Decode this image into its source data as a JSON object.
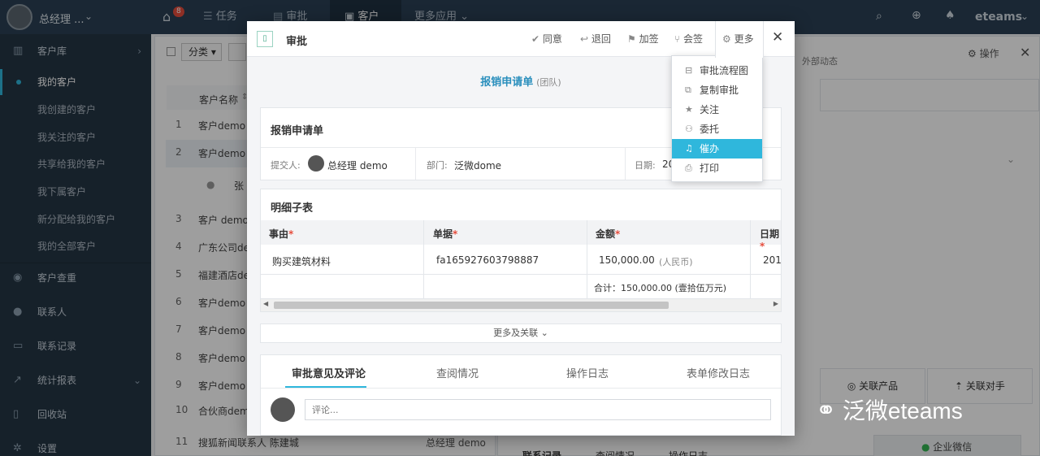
{
  "topbar": {
    "user": "总经理 ...",
    "home_badge": "8",
    "nav": [
      "任务",
      "审批",
      "客户",
      "更多应用"
    ],
    "brand": "eteams"
  },
  "sidebar": {
    "items": [
      {
        "label": "客户库",
        "icon": "bar-chart-icon",
        "main": true
      },
      {
        "label": "我的客户",
        "active": true
      },
      {
        "label": "我创建的客户"
      },
      {
        "label": "我关注的客户"
      },
      {
        "label": "共享给我的客户"
      },
      {
        "label": "我下属客户"
      },
      {
        "label": "新分配给我的客户"
      },
      {
        "label": "我的全部客户"
      },
      {
        "label": "客户查重",
        "icon": "eye-icon",
        "main": true
      },
      {
        "label": "联系人",
        "icon": "user-icon",
        "main": true
      },
      {
        "label": "联系记录",
        "icon": "comment-icon",
        "main": true
      },
      {
        "label": "统计报表",
        "icon": "line-chart-icon",
        "main": true
      },
      {
        "label": "回收站",
        "icon": "trash-icon",
        "main": true
      },
      {
        "label": "设置",
        "icon": "gear-icon",
        "main": true
      }
    ]
  },
  "background": {
    "filter_label": "分类",
    "col_name": "客户名称",
    "rows": [
      {
        "n": "1",
        "name": "客户demo"
      },
      {
        "n": "2",
        "name": "客户demo"
      },
      {
        "n": "",
        "name": "张"
      },
      {
        "n": "3",
        "name": "客户 demo"
      },
      {
        "n": "4",
        "name": "广东公司de"
      },
      {
        "n": "5",
        "name": "福建酒店de"
      },
      {
        "n": "6",
        "name": "客户demo"
      },
      {
        "n": "7",
        "name": "客户demo"
      },
      {
        "n": "8",
        "name": "客户demo"
      },
      {
        "n": "9",
        "name": "客户demo"
      },
      {
        "n": "10",
        "name": "合伙商dem"
      },
      {
        "n": "11",
        "name": "搜狐新闻联系人 陈建城"
      }
    ],
    "row11_owner": "总经理 demo",
    "right_tab": "外部动态",
    "right_action": "操作",
    "related_product": "关联产品",
    "related_rival": "关联对手",
    "bottom_tabs": [
      "联系记录",
      "查阅情况",
      "操作日志"
    ],
    "wechat_label": "企业微信"
  },
  "modal": {
    "title": "审批",
    "actions": {
      "agree": "同意",
      "reject": "退回",
      "add_sign": "加签",
      "countersign": "会签",
      "more": "更多"
    },
    "form_title": "报销申请单",
    "form_scope": "(团队)",
    "section_title": "报销申请单",
    "submitter_label": "提交人:",
    "submitter": "总经理 demo",
    "dept_label": "部门:",
    "dept": "泛微dome",
    "date_label": "日期:",
    "date_value": "20",
    "detail_title": "明细子表",
    "columns": [
      "事由",
      "单据",
      "金额",
      "日期"
    ],
    "row": {
      "reason": "购买建筑材料",
      "doc": "fa165927603798887",
      "amount": "150,000.00",
      "currency": "(人民币)",
      "date": "201"
    },
    "total": "合计：150,000.00 (壹拾伍万元)",
    "more_link": "更多及关联",
    "tabs": [
      "审批意见及评论",
      "查阅情况",
      "操作日志",
      "表单修改日志"
    ],
    "comment_placeholder": "评论..."
  },
  "dropdown": {
    "items": [
      {
        "label": "审批流程图",
        "icon": "flow-icon"
      },
      {
        "label": "复制审批",
        "icon": "copy-icon"
      },
      {
        "label": "关注",
        "icon": "star-icon"
      },
      {
        "label": "委托",
        "icon": "delegate-icon"
      },
      {
        "label": "催办",
        "icon": "bell-icon",
        "highlight": true
      },
      {
        "label": "打印",
        "icon": "print-icon"
      }
    ]
  },
  "watermark": "泛微eteams"
}
